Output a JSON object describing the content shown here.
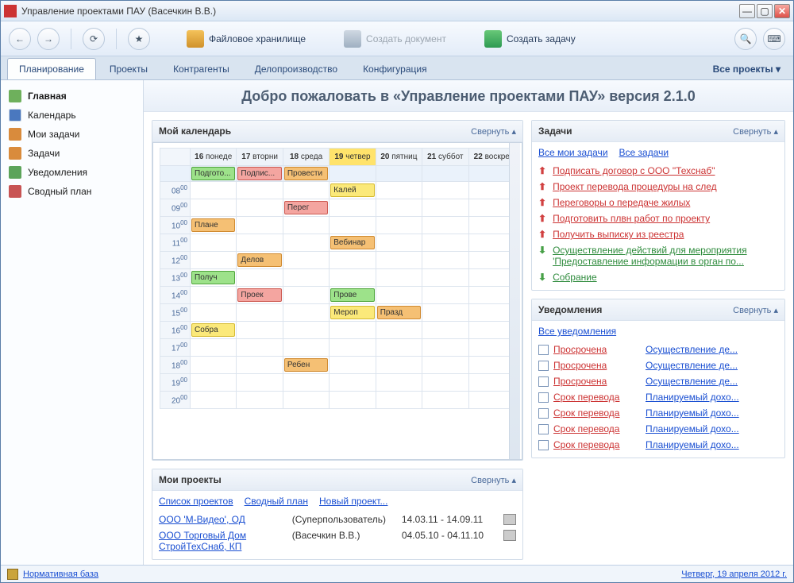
{
  "window": {
    "title": "Управление проектами ПАУ (Васечкин В.В.)"
  },
  "toolbar": {
    "filestore": "Файловое хранилище",
    "createDoc": "Создать документ",
    "createTask": "Создать задачу"
  },
  "tabs": {
    "items": [
      "Планирование",
      "Проекты",
      "Контрагенты",
      "Делопроизводство",
      "Конфигурация"
    ],
    "right": "Все проекты ▾"
  },
  "sidebar": {
    "items": [
      {
        "label": "Главная"
      },
      {
        "label": "Календарь"
      },
      {
        "label": "Мои задачи"
      },
      {
        "label": "Задачи"
      },
      {
        "label": "Уведомления"
      },
      {
        "label": "Сводный план"
      }
    ]
  },
  "welcome": "Добро пожаловать в «Управление проектами ПАУ» версия 2.1.0",
  "collapse": "Свернуть ▴",
  "calendarPanel": {
    "title": "Мой календарь",
    "days": [
      {
        "num": "16",
        "name": "понеде"
      },
      {
        "num": "17",
        "name": "вторни"
      },
      {
        "num": "18",
        "name": "среда"
      },
      {
        "num": "19",
        "name": "четвер",
        "today": true
      },
      {
        "num": "20",
        "name": "пятниц"
      },
      {
        "num": "21",
        "name": "суббот"
      },
      {
        "num": "22",
        "name": "воскре"
      }
    ],
    "hours": [
      "08",
      "09",
      "10",
      "11",
      "12",
      "13",
      "14",
      "15",
      "16",
      "17",
      "18",
      "19",
      "20"
    ],
    "allday": [
      {
        "day": 0,
        "label": "Подгото...",
        "color": "green"
      },
      {
        "day": 1,
        "label": "Подпис...",
        "color": "red"
      },
      {
        "day": 2,
        "label": "Провести",
        "color": "orange"
      }
    ],
    "events": [
      {
        "day": 3,
        "hour": "08",
        "label": "Калей",
        "color": "yellow"
      },
      {
        "day": 2,
        "hour": "09",
        "label": "Перег",
        "color": "red"
      },
      {
        "day": 0,
        "hour": "10",
        "label": "Плане",
        "color": "orange"
      },
      {
        "day": 3,
        "hour": "11",
        "label": "Вебинар",
        "color": "orange",
        "span": 2
      },
      {
        "day": 1,
        "hour": "12",
        "label": "Делов",
        "color": "orange"
      },
      {
        "day": 0,
        "hour": "13",
        "label": "Получ",
        "color": "green"
      },
      {
        "day": 1,
        "hour": "14",
        "label": "Проек",
        "color": "red"
      },
      {
        "day": 3,
        "hour": "14",
        "label": "Прове",
        "color": "green"
      },
      {
        "day": 3,
        "hour": "15",
        "label": "Мероп",
        "color": "yellow"
      },
      {
        "day": 4,
        "hour": "15",
        "label": "Празд",
        "color": "orange"
      },
      {
        "day": 0,
        "hour": "16",
        "label": "Собра",
        "color": "yellow"
      },
      {
        "day": 2,
        "hour": "18",
        "label": "Ребен",
        "color": "orange"
      }
    ]
  },
  "tasksPanel": {
    "title": "Задачи",
    "links": {
      "myAll": "Все мои задачи",
      "all": "Все задачи"
    },
    "tasks": [
      {
        "dir": "up",
        "label": "Подписать договор с ООО \"Техснаб\""
      },
      {
        "dir": "up",
        "label": "Проект перевода процедуры на след"
      },
      {
        "dir": "up",
        "label": "Переговоры о передаче жилых"
      },
      {
        "dir": "up",
        "label": "Подготовить плвн работ по проекту"
      },
      {
        "dir": "up",
        "label": "Получить выписку из реестра"
      },
      {
        "dir": "down",
        "label": "Осуществление действий для мероприятия 'Предоставление информации в орган по..."
      },
      {
        "dir": "down",
        "label": "Собрание"
      }
    ]
  },
  "notifPanel": {
    "title": "Уведомления",
    "allLink": "Все уведомления",
    "rows": [
      {
        "status": "Просрочена",
        "desc": "Осуществление де..."
      },
      {
        "status": "Просрочена",
        "desc": "Осуществление де..."
      },
      {
        "status": "Просрочена",
        "desc": "Осуществление де..."
      },
      {
        "status": "Срок перевода",
        "desc": "Планируемый дохо..."
      },
      {
        "status": "Срок перевода",
        "desc": "Планируемый дохо..."
      },
      {
        "status": "Срок перевода",
        "desc": "Планируемый дохо..."
      },
      {
        "status": "Срок перевода",
        "desc": "Планируемый дохо..."
      }
    ]
  },
  "projectsPanel": {
    "title": "Мои проекты",
    "links": {
      "list": "Список проектов",
      "plan": "Сводный план",
      "new": "Новый проект..."
    },
    "rows": [
      {
        "name": "ООО 'М-Видео', ОД",
        "owner": "(Суперпользователь)",
        "dates": "14.03.11 - 14.09.11"
      },
      {
        "name": "ООО Торговый Дом СтройТехСнаб, КП",
        "owner": "(Васечкин В.В.)",
        "dates": "04.05.10 - 04.11.10"
      }
    ]
  },
  "statusbar": {
    "left": "Нормативная база",
    "right": "Четверг, 19 апреля 2012 г."
  }
}
